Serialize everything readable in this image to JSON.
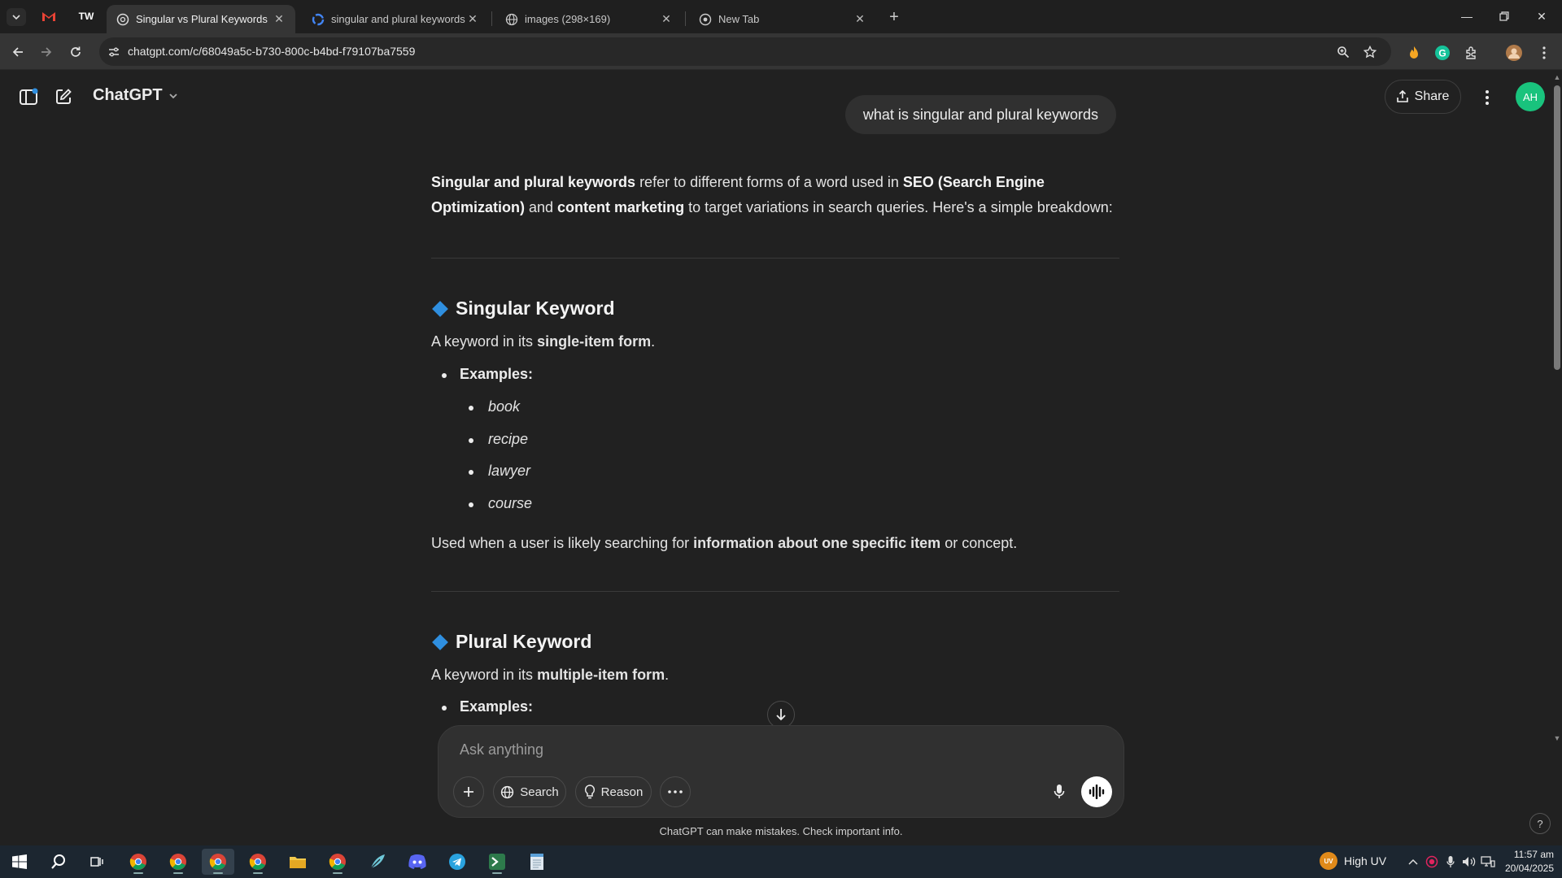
{
  "browser": {
    "pinned_tabs": [
      {
        "name": "gmail-tab",
        "icon": "gmail-icon",
        "glyph": "M"
      },
      {
        "name": "tw-tab",
        "icon": "tw-logo-icon",
        "glyph": "TW"
      }
    ],
    "tabs": [
      {
        "title": "Singular vs Plural Keywords",
        "icon": "chatgpt-icon",
        "active": true
      },
      {
        "title": "singular and plural keywords - G",
        "icon": "google-icon",
        "active": false
      },
      {
        "title": "images (298×169)",
        "icon": "globe-icon",
        "active": false
      },
      {
        "title": "New Tab",
        "icon": "chrome-icon",
        "active": false
      }
    ],
    "url": "chatgpt.com/c/68049a5c-b730-800c-b4bd-f79107ba7559"
  },
  "header": {
    "model_name": "ChatGPT",
    "share_label": "Share",
    "avatar_initials": "AH"
  },
  "conversation": {
    "user_message": "what is singular and plural keywords",
    "intro": {
      "bold1": "Singular and plural keywords",
      "text1": " refer to different forms of a word used in ",
      "bold2": "SEO (Search Engine Optimization)",
      "text2": " and ",
      "bold3": "content marketing",
      "text3": " to target variations in search queries. Here's a simple breakdown:"
    },
    "singular": {
      "heading": "Singular Keyword",
      "desc_pre": "A keyword in its ",
      "desc_bold": "single-item form",
      "desc_post": ".",
      "examples_label": "Examples:",
      "examples": [
        "book",
        "recipe",
        "lawyer",
        "course"
      ],
      "usage_pre": "Used when a user is likely searching for ",
      "usage_bold": "information about one specific item",
      "usage_post": " or concept."
    },
    "plural": {
      "heading": "Plural Keyword",
      "desc_pre": "A keyword in its ",
      "desc_bold": "multiple-item form",
      "desc_post": ".",
      "examples_label": "Examples:"
    }
  },
  "composer": {
    "placeholder": "Ask anything",
    "search_label": "Search",
    "reason_label": "Reason",
    "disclaimer": "ChatGPT can make mistakes. Check important info."
  },
  "taskbar": {
    "weather": "High UV",
    "weather_badge": "UV",
    "time": "11:57 am",
    "date": "20/04/2025"
  },
  "colors": {
    "page_bg": "#212121",
    "accent_diamond": "#2f8fe0",
    "avatar_bg": "#19c37d"
  }
}
